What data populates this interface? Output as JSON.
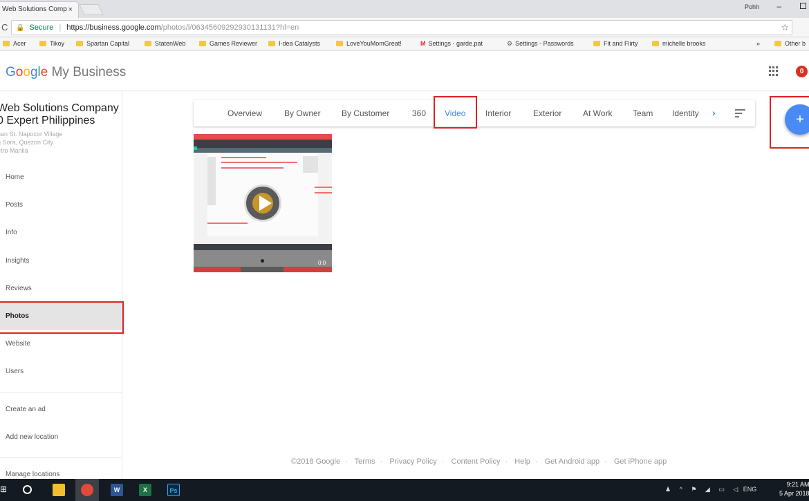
{
  "browser": {
    "tab_title": "Web Solutions Comp",
    "tab_close": "×",
    "window_user": "Pohh",
    "secure_label": "Secure",
    "url_host": "https://business.google.com",
    "url_path": "/photos/l/06345609292930131131?hl=en",
    "bookmarks": [
      {
        "label": "Acer",
        "icon": "folder-icon"
      },
      {
        "label": "Tikoy",
        "icon": "folder-icon"
      },
      {
        "label": "Spartan Capital",
        "icon": "folder-icon"
      },
      {
        "label": "StatenWeb",
        "icon": "folder-icon"
      },
      {
        "label": "Games Reviewer",
        "icon": "folder-icon"
      },
      {
        "label": "I-dea Catalysts",
        "icon": "folder-icon"
      },
      {
        "label": "LoveYouMomGreat!",
        "icon": "folder-icon"
      },
      {
        "label": "Settings - garde.pat",
        "icon": "gmail-icon"
      },
      {
        "label": "Settings - Passwords",
        "icon": "gear-icon"
      },
      {
        "label": "Fit and Flirty",
        "icon": "folder-icon"
      },
      {
        "label": "michelle brooks",
        "icon": "folder-icon"
      },
      {
        "label": "Other b",
        "icon": "folder-icon"
      }
    ],
    "bookmarks_overflow": "»"
  },
  "app": {
    "logo_rest": "My Business",
    "notification_count": "0"
  },
  "sidebar": {
    "business_name_line1": "Web Solutions Company",
    "business_name_line2": "0 Expert Philippines",
    "address_line1": "uan St. Napocor Village",
    "address_line2": "g Sora, Quezon City",
    "address_line3": "etro Manila",
    "nav": [
      {
        "label": "Home"
      },
      {
        "label": "Posts"
      },
      {
        "label": "Info"
      },
      {
        "label": "Insights"
      },
      {
        "label": "Reviews"
      },
      {
        "label": "Photos",
        "active": true
      },
      {
        "label": "Website"
      },
      {
        "label": "Users"
      }
    ],
    "nav_secondary": [
      {
        "label": "Create an ad"
      },
      {
        "label": "Add new location"
      }
    ],
    "manage_locations": "Manage locations"
  },
  "categories": {
    "tabs": [
      {
        "label": "Overview"
      },
      {
        "label": "By Owner"
      },
      {
        "label": "By Customer"
      },
      {
        "label": "360"
      },
      {
        "label": "Video",
        "active": true
      },
      {
        "label": "Interior"
      },
      {
        "label": "Exterior"
      },
      {
        "label": "At Work"
      },
      {
        "label": "Team"
      },
      {
        "label": "Identity"
      }
    ],
    "next_label": "›"
  },
  "fab_label": "+",
  "video": {
    "duration": "0:0"
  },
  "footer": {
    "links": [
      "©2018 Google",
      "Terms",
      "Privacy Policy",
      "Content Policy",
      "Help",
      "Get Android app",
      "Get iPhone app"
    ]
  },
  "taskbar": {
    "apps": [
      {
        "label": "",
        "icon": "file-explorer-icon",
        "color": "#f0c030"
      },
      {
        "label": "",
        "icon": "chrome-icon",
        "color": "#e04a3a"
      },
      {
        "label": "W",
        "icon": "word-icon",
        "color": "#2b5797"
      },
      {
        "label": "X",
        "icon": "excel-icon",
        "color": "#1e7145"
      },
      {
        "label": "Ps",
        "icon": "photoshop-icon",
        "color": "#0c2a3d"
      }
    ],
    "lang": "ENG",
    "time": "9:21 AM",
    "date": "5 Apr 2018"
  },
  "colors": {
    "accent": "#4285f4",
    "highlight_box": "#e02020",
    "fab": "#4a8af4"
  }
}
